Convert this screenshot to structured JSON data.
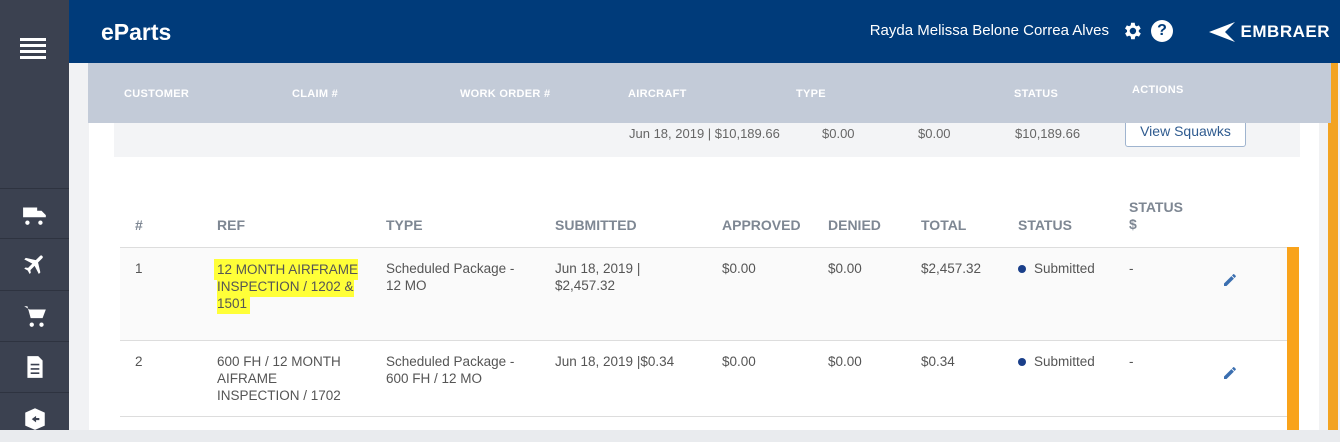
{
  "header": {
    "brand": "eParts",
    "user_name": "Rayda Melissa Belone Correa Alves",
    "logo_text": "EMBRAER"
  },
  "sidebar": {
    "items": [
      {
        "icon": "truck-icon"
      },
      {
        "icon": "airplane-icon"
      },
      {
        "icon": "cart-icon"
      },
      {
        "icon": "document-icon"
      },
      {
        "icon": "package-return-icon"
      }
    ]
  },
  "columns": {
    "customer": "CUSTOMER",
    "claim": "CLAIM #",
    "work_order": "WORK ORDER #",
    "aircraft": "AIRCRAFT",
    "type": "TYPE",
    "status": "STATUS",
    "actions": "ACTIONS"
  },
  "summary": {
    "submitted": "Jun 18, 2019 | $10,189.66",
    "approved": "$0.00",
    "denied": "$0.00",
    "total": "$10,189.66",
    "view_button": "View Squawks"
  },
  "table": {
    "headers": [
      "#",
      "REF",
      "TYPE",
      "SUBMITTED",
      "APPROVED",
      "DENIED",
      "TOTAL",
      "STATUS",
      "STATUS $"
    ],
    "rows": [
      {
        "num": "1",
        "ref": "12 MONTH AIRFRAME INSPECTION / 1202 & 1501",
        "type": "Scheduled Package - 12 MO",
        "submitted": "Jun 18, 2019 | $2,457.32",
        "approved": "$0.00",
        "denied": "$0.00",
        "total": "$2,457.32",
        "status": "Submitted",
        "status_amount": "-"
      },
      {
        "num": "2",
        "ref": "600 FH / 12 MONTH AIFRAME INSPECTION / 1702",
        "type": "Scheduled Package - 600 FH / 12 MO",
        "submitted": "Jun 18, 2019 |$0.34",
        "approved": "$0.00",
        "denied": "$0.00",
        "total": "$0.34",
        "status": "Submitted",
        "status_amount": "-"
      }
    ]
  },
  "colors": {
    "header_bg": "#003b7a",
    "sidebar_bg": "#3b4150",
    "accent_orange": "#f9a31b",
    "highlight": "#ffff38"
  }
}
